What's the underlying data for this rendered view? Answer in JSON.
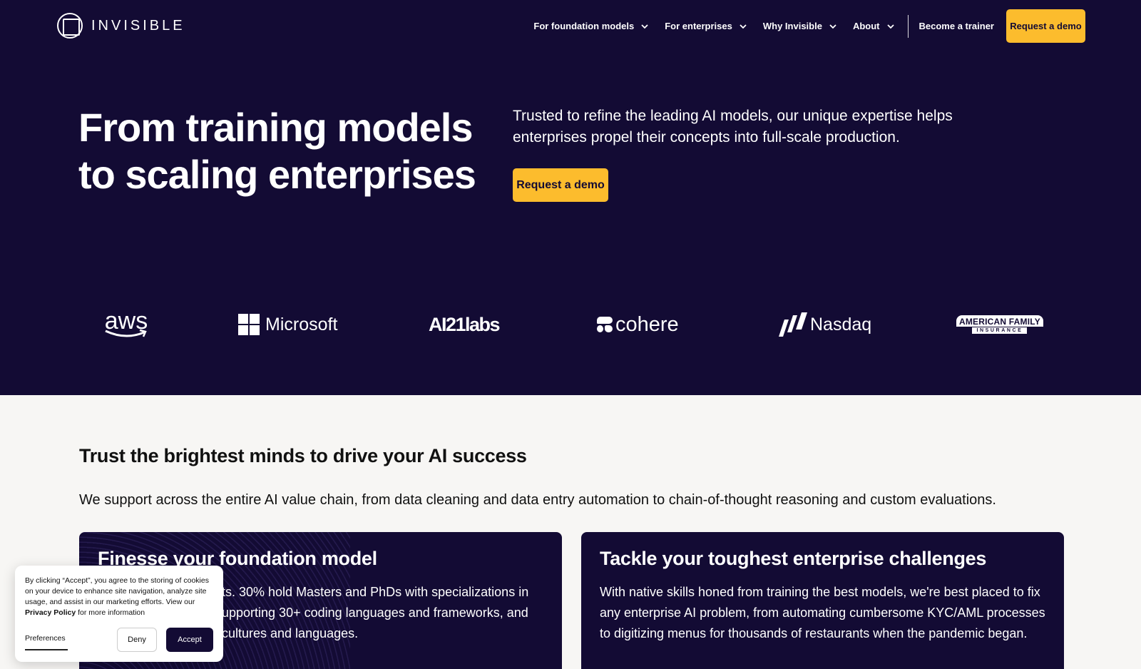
{
  "brand": {
    "name": "INVISIBLE"
  },
  "nav": {
    "items": [
      {
        "label": "For foundation models"
      },
      {
        "label": "For enterprises"
      },
      {
        "label": "Why Invisible"
      },
      {
        "label": "About"
      }
    ],
    "trainer_link": "Become a trainer",
    "demo_button": "Request a demo"
  },
  "hero": {
    "title_line1": "From training models",
    "title_line2": "to scaling enterprises",
    "subtitle": "Trusted to refine the leading AI models, our unique expertise helps enterprises propel their concepts into full-scale production.",
    "cta": "Request a demo"
  },
  "logos": {
    "aws": "aws",
    "microsoft": "Microsoft",
    "ai21": "AI21labs",
    "cohere": "cohere",
    "nasdaq": "Nasdaq",
    "amfam_top": "AMERICAN FAMILY",
    "amfam_bottom": "INSURANCE"
  },
  "section": {
    "title": "Trust the brightest minds to drive your AI success",
    "text": "We support across the entire AI value chain, from data cleaning and data entry automation to chain-of-thought reasoning and custom evaluations."
  },
  "cards": [
    {
      "title": "Finesse your foundation model",
      "body": "ts. 30% hold Masters and PhDs with specializations in upporting 30+ coding languages and frameworks, and cultures and languages."
    },
    {
      "title": "Tackle your toughest enterprise challenges",
      "body": "With native skills honed from training the best models, we're best placed to fix any enterprise AI problem, from automating cumbersome KYC/AML processes to digitizing menus for thousands of restaurants when the pandemic began."
    }
  ],
  "cookie": {
    "text_before": "By clicking “Accept”, you agree to the storing of cookies on your device to enhance site navigation, analyze site usage, and assist in our marketing efforts. View our ",
    "policy_link": "Privacy Policy",
    "text_after": " for more information",
    "preferences": "Preferences",
    "deny": "Deny",
    "accept": "Accept"
  },
  "colors": {
    "navy": "#130b34",
    "yellow": "#fcbc2d",
    "light_bg": "#f7f6f4"
  }
}
